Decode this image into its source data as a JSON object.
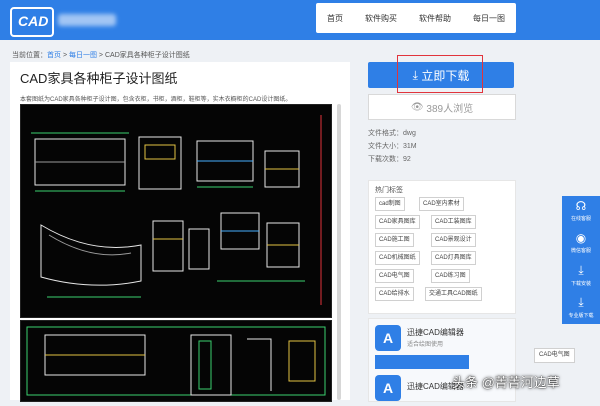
{
  "header": {
    "logo_text": "CAD",
    "nav": [
      "首页",
      "软件购买",
      "软件帮助",
      "每日一图"
    ]
  },
  "breadcrumb": {
    "prefix": "当前位置：",
    "items": [
      "首页",
      "每日一图",
      "CAD家具各种柜子设计图纸"
    ],
    "sep": " > "
  },
  "main": {
    "title": "CAD家具各种柜子设计图纸",
    "description": "本套图纸为CAD家具各种柜子设计图，包含衣柜，书柜，酒柜，鞋柜等，实木衣橱柜的CAD设计图纸。"
  },
  "side": {
    "download_label": "立即下载",
    "views_label": "389人浏览",
    "file_format": "文件格式：dwg",
    "file_size": "文件大小：31M",
    "download_count": "下载次数：92",
    "tags_title": "热门标签",
    "tags": [
      "cad制图",
      "CAD室内素材",
      "CAD家具图库",
      "CAD工装图库",
      "CAD施工图",
      "CAD景观设计",
      "CAD机械图纸",
      "CAD灯具图库",
      "CAD电气图",
      "CAD练习图",
      "CAD给排水",
      "交通工具CAD图纸"
    ],
    "ads": [
      {
        "title": "迅捷CAD编辑器",
        "subtitle": "适合绘图使用"
      },
      {
        "title": "迅捷CAD编辑器",
        "subtitle": ""
      }
    ],
    "floating_tag": "CAD电气图"
  },
  "float_menu": [
    "在线客服",
    "微信客服",
    "下载安装",
    "专业版下载"
  ],
  "watermark": "头条 @菁菁河边草",
  "colors": {
    "accent": "#2f7fe6",
    "highlight": "#e1343c"
  }
}
